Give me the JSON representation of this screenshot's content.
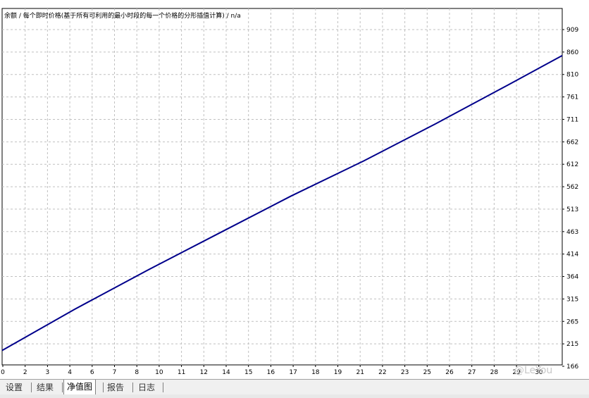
{
  "chart_data": {
    "type": "line",
    "title": "余额 / 每个即时价格(基于所有可利用的最小时段的每一个价格的分形插值计算) / n/a",
    "x_ticks": [
      "0",
      "2",
      "3",
      "4",
      "6",
      "7",
      "8",
      "10",
      "11",
      "12",
      "14",
      "15",
      "16",
      "17",
      "18",
      "19",
      "21",
      "22",
      "23",
      "25",
      "26",
      "27",
      "28",
      "29",
      "30"
    ],
    "y_ticks": [
      "909",
      "860",
      "810",
      "761",
      "711",
      "662",
      "612",
      "562",
      "513",
      "463",
      "414",
      "364",
      "315",
      "265",
      "215",
      "166"
    ],
    "ylim": [
      166,
      930
    ],
    "xlim": [
      0,
      31
    ],
    "grid": true,
    "series": [
      {
        "color": "#00008b",
        "x": [
          0,
          4,
          8,
          12,
          16,
          20,
          24,
          28,
          31
        ],
        "y": [
          197,
          285,
          368,
          448,
          528,
          603,
          683,
          766,
          829
        ]
      }
    ]
  },
  "tabs": [
    {
      "label": "设置",
      "active": false
    },
    {
      "label": "结果",
      "active": false
    },
    {
      "label": "净值图",
      "active": true
    },
    {
      "label": "报告",
      "active": false
    },
    {
      "label": "日志",
      "active": false
    }
  ],
  "watermark": "@LeYou"
}
